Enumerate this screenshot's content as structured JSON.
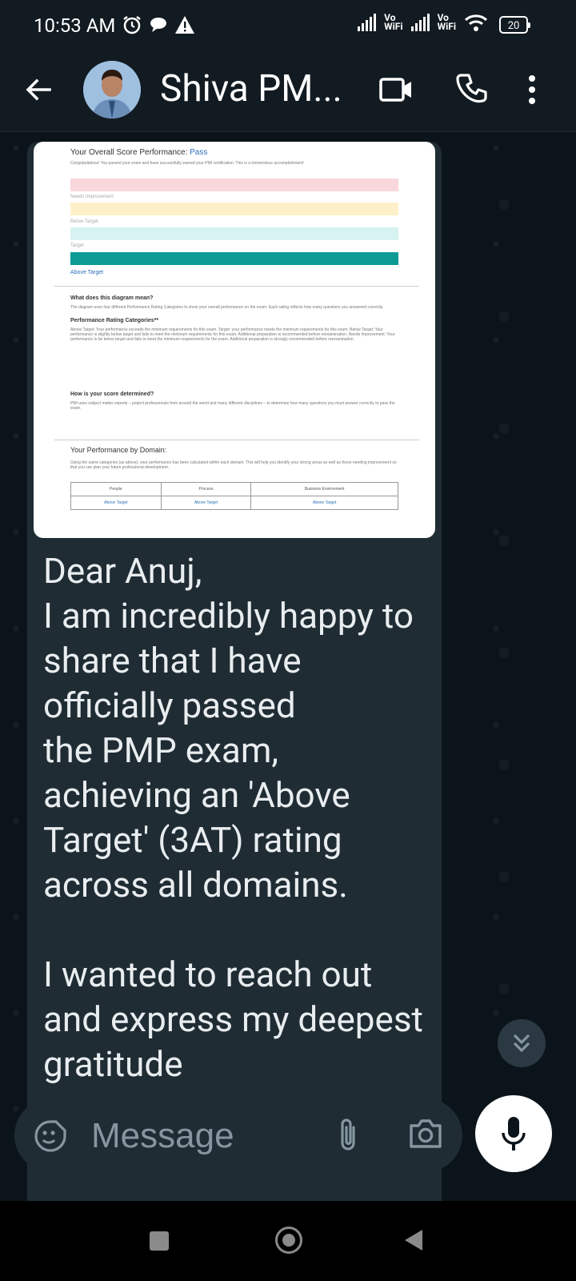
{
  "status_bar": {
    "time": "10:53 AM",
    "left_icons": [
      "alarm-icon",
      "chat-notification-icon",
      "warning-icon"
    ],
    "vowifi_label_1": "Vo\nWiFi",
    "vowifi_label_2": "Vo\nWiFi",
    "battery": "20"
  },
  "header": {
    "contact_name": "Shiva PM...",
    "icons": [
      "back-arrow-icon",
      "video-call-icon",
      "phone-icon",
      "more-vert-icon"
    ]
  },
  "image_message": {
    "title": "Your Overall Score Performance: ",
    "result": "Pass",
    "congrats": "Congratulations! You passed your exam and have successfully earned your PMI certification. This is a tremendous accomplishment!",
    "bar_labels": [
      "Needs Improvement",
      "Below Target",
      "Target",
      "Above Target"
    ],
    "bar_colors": [
      "#f9d7dc",
      "#fdf0c9",
      "#d6f3f1",
      "#0b9b94"
    ],
    "diagram_heading": "What does this diagram mean?",
    "diagram_text": "The diagram uses four different Performance Rating Categories to show your overall performance on the exam. Each rating reflects how many questions you answered correctly.",
    "categories_heading": "Performance Rating Categories**",
    "categories_text": "Above Target: Your performance exceeds the minimum requirements for this exam. Target: your performance meets the minimum requirements for this exam. Below Target: Your performance is slightly below target and fails to meet the minimum requirements for this exam. Additional preparation is recommended before reexamination. Needs Improvement: Your performance is far below target and fails to meet the minimum requirements for the exam. Additional preparation is strongly recommended before reexamination.",
    "determined_heading": "How is your score determined?",
    "determined_text": "PMI uses subject matter experts – project professionals from around the world and many different disciplines – to determine how many questions you must answer correctly to pass the exam.",
    "domain_heading": "Your Performance by Domain:",
    "domain_text": "Using the same categories (as above), your performance has been calculated within each domain. This will help you identify your strong areas as well as those needing improvement so that you can plan your future professional development.",
    "domain_table": {
      "headers": [
        "People",
        "Process",
        "Business Environment"
      ],
      "values": [
        "Above Target",
        "Above Target",
        "Above Target"
      ]
    }
  },
  "message": {
    "text": "Dear Anuj,\nI am incredibly happy to share that I have officially passed\nthe PMP exam, achieving an 'Above Target' (3AT) rating across all domains.\n\nI wanted to reach out and express my deepest gratitude"
  },
  "input_bar": {
    "placeholder": "Message",
    "icons": [
      "sticker-icon",
      "attach-icon",
      "camera-icon",
      "mic-icon"
    ]
  },
  "nav_bar": {
    "icons": [
      "recents-icon",
      "home-icon",
      "back-icon"
    ]
  }
}
